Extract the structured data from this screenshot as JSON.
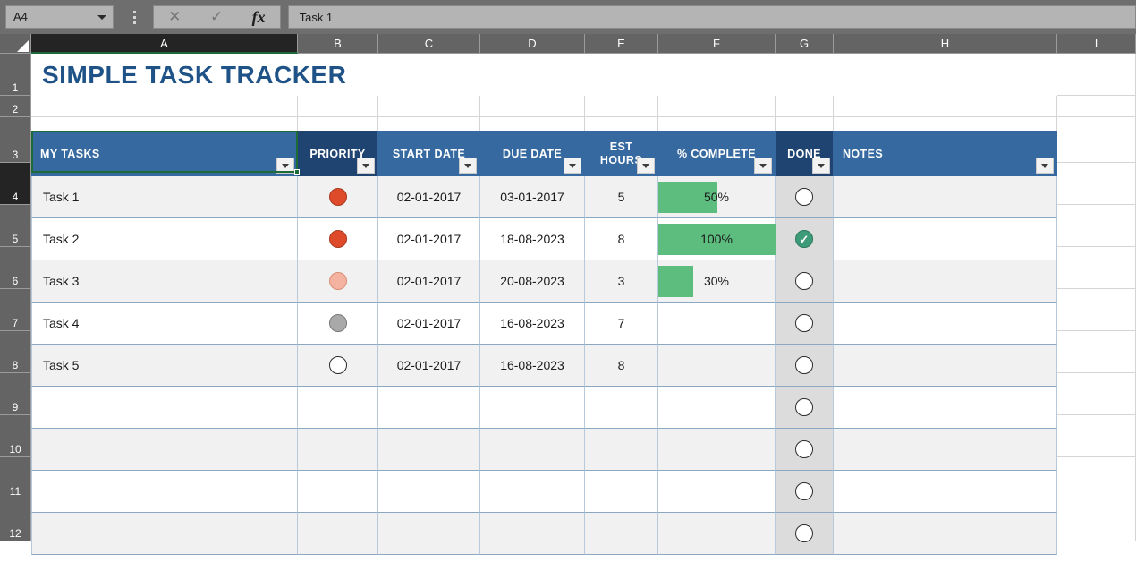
{
  "formula_bar": {
    "name_box_value": "A4",
    "cancel_icon": "cancel-x-icon",
    "accept_icon": "accept-check-icon",
    "function_icon": "fx",
    "formula_value": "Task 1"
  },
  "grid": {
    "column_headers": [
      "A",
      "B",
      "C",
      "D",
      "E",
      "F",
      "G",
      "H",
      "I"
    ],
    "selected_column": "A",
    "row_headers": [
      "1",
      "2",
      "3",
      "4",
      "5",
      "6",
      "7",
      "8",
      "9",
      "10",
      "11",
      "12"
    ],
    "selected_row": "4"
  },
  "sheet": {
    "title": "SIMPLE TASK TRACKER",
    "table": {
      "headers": [
        {
          "label": "MY TASKS",
          "dark": false,
          "center": false,
          "two_line": false
        },
        {
          "label": "PRIORITY",
          "dark": true,
          "center": true,
          "two_line": false
        },
        {
          "label": "START DATE",
          "dark": false,
          "center": true,
          "two_line": false
        },
        {
          "label": "DUE DATE",
          "dark": false,
          "center": true,
          "two_line": false
        },
        {
          "label_line1": "EST",
          "label_line2": "HOURS",
          "dark": false,
          "center": true,
          "two_line": true
        },
        {
          "label": "% COMPLETE",
          "dark": false,
          "center": true,
          "two_line": false
        },
        {
          "label": "DONE",
          "dark": true,
          "center": true,
          "two_line": false
        },
        {
          "label": "NOTES",
          "dark": false,
          "center": false,
          "two_line": false
        }
      ],
      "rows": [
        {
          "task": "Task 1",
          "priority": "high",
          "start_date": "02-01-2017",
          "due_date": "03-01-2017",
          "est_hours": "5",
          "percent": "50%",
          "percent_value": 50,
          "done": false,
          "notes": ""
        },
        {
          "task": "Task 2",
          "priority": "high",
          "start_date": "02-01-2017",
          "due_date": "18-08-2023",
          "est_hours": "8",
          "percent": "100%",
          "percent_value": 100,
          "done": true,
          "notes": ""
        },
        {
          "task": "Task 3",
          "priority": "med",
          "start_date": "02-01-2017",
          "due_date": "20-08-2023",
          "est_hours": "3",
          "percent": "30%",
          "percent_value": 30,
          "done": false,
          "notes": ""
        },
        {
          "task": "Task 4",
          "priority": "low",
          "start_date": "02-01-2017",
          "due_date": "16-08-2023",
          "est_hours": "7",
          "percent": "",
          "percent_value": 0,
          "done": false,
          "notes": ""
        },
        {
          "task": "Task 5",
          "priority": "none",
          "start_date": "02-01-2017",
          "due_date": "16-08-2023",
          "est_hours": "8",
          "percent": "",
          "percent_value": 0,
          "done": false,
          "notes": ""
        },
        {
          "task": "",
          "priority": "",
          "start_date": "",
          "due_date": "",
          "est_hours": "",
          "percent": "",
          "percent_value": 0,
          "done": false,
          "notes": ""
        },
        {
          "task": "",
          "priority": "",
          "start_date": "",
          "due_date": "",
          "est_hours": "",
          "percent": "",
          "percent_value": 0,
          "done": false,
          "notes": ""
        },
        {
          "task": "",
          "priority": "",
          "start_date": "",
          "due_date": "",
          "est_hours": "",
          "percent": "",
          "percent_value": 0,
          "done": false,
          "notes": ""
        },
        {
          "task": "",
          "priority": "",
          "start_date": "",
          "due_date": "",
          "est_hours": "",
          "percent": "",
          "percent_value": 0,
          "done": false,
          "notes": ""
        }
      ],
      "done_check_glyph": "✓"
    }
  },
  "colors": {
    "header_blue": "#36699f",
    "header_blue_dark": "#1f4471",
    "title_blue": "#1f5387",
    "progress_green": "#5cbd7e",
    "done_green": "#3d9b79",
    "priority_high": "#dd4b2a",
    "priority_med": "#f4b3a0",
    "priority_low": "#a9a9a9",
    "selection_green": "#1e6b3a",
    "row_band": "#f1f1f1",
    "done_col_bg": "#dcdcdc",
    "chrome_gray": "#6e6e6e",
    "header_gray": "#646464"
  }
}
